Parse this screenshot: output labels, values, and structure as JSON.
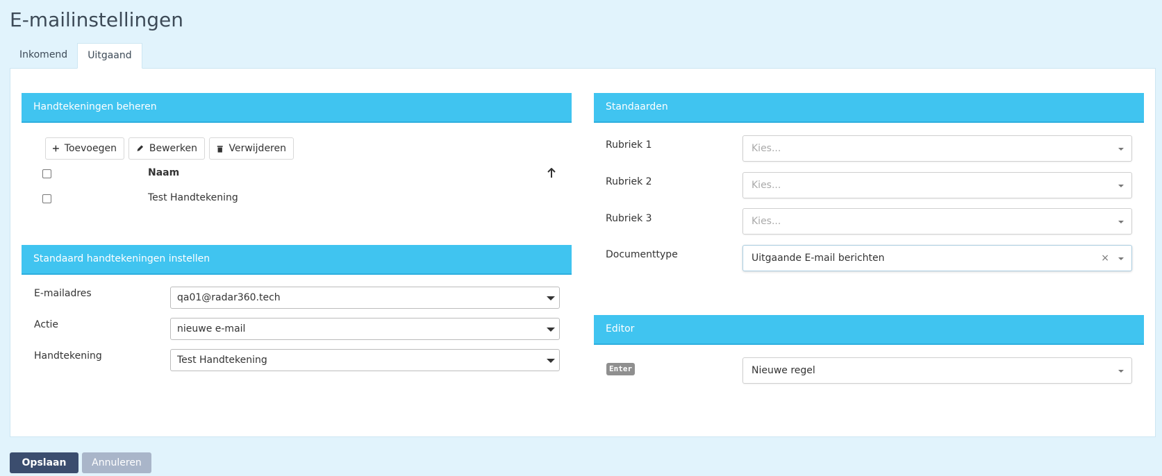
{
  "page": {
    "title": "E-mailinstellingen"
  },
  "tabs": [
    {
      "label": "Inkomend",
      "active": false
    },
    {
      "label": "Uitgaand",
      "active": true
    }
  ],
  "signatures": {
    "header": "Handtekeningen beheren",
    "toolbar": {
      "add_label": "Toevoegen",
      "edit_label": "Bewerken",
      "delete_label": "Verwijderen"
    },
    "table": {
      "column_name": "Naam",
      "rows": [
        {
          "name": "Test Handtekening"
        }
      ]
    }
  },
  "default_signatures": {
    "header": "Standaard handtekeningen instellen",
    "fields": [
      {
        "label": "E-mailadres",
        "value": "qa01@radar360.tech"
      },
      {
        "label": "Actie",
        "value": "nieuwe e-mail"
      },
      {
        "label": "Handtekening",
        "value": "Test Handtekening"
      }
    ]
  },
  "defaults": {
    "header": "Standaarden",
    "fields": [
      {
        "label": "Rubriek 1",
        "value": "Kies..."
      },
      {
        "label": "Rubriek 2",
        "value": "Kies..."
      },
      {
        "label": "Rubriek 3",
        "value": "Kies..."
      },
      {
        "label": "Documenttype",
        "value": "Uitgaande E-mail berichten",
        "clear": "×"
      }
    ]
  },
  "editor": {
    "header": "Editor",
    "key": "Enter",
    "value": "Nieuwe regel"
  },
  "actions": {
    "save_label": "Opslaan",
    "cancel_label": "Annuleren"
  },
  "colors": {
    "background": "#e1f3fc",
    "section_header": "#40c4f0",
    "save_button": "#3b4d6e",
    "cancel_button": "#a9b5c9"
  }
}
